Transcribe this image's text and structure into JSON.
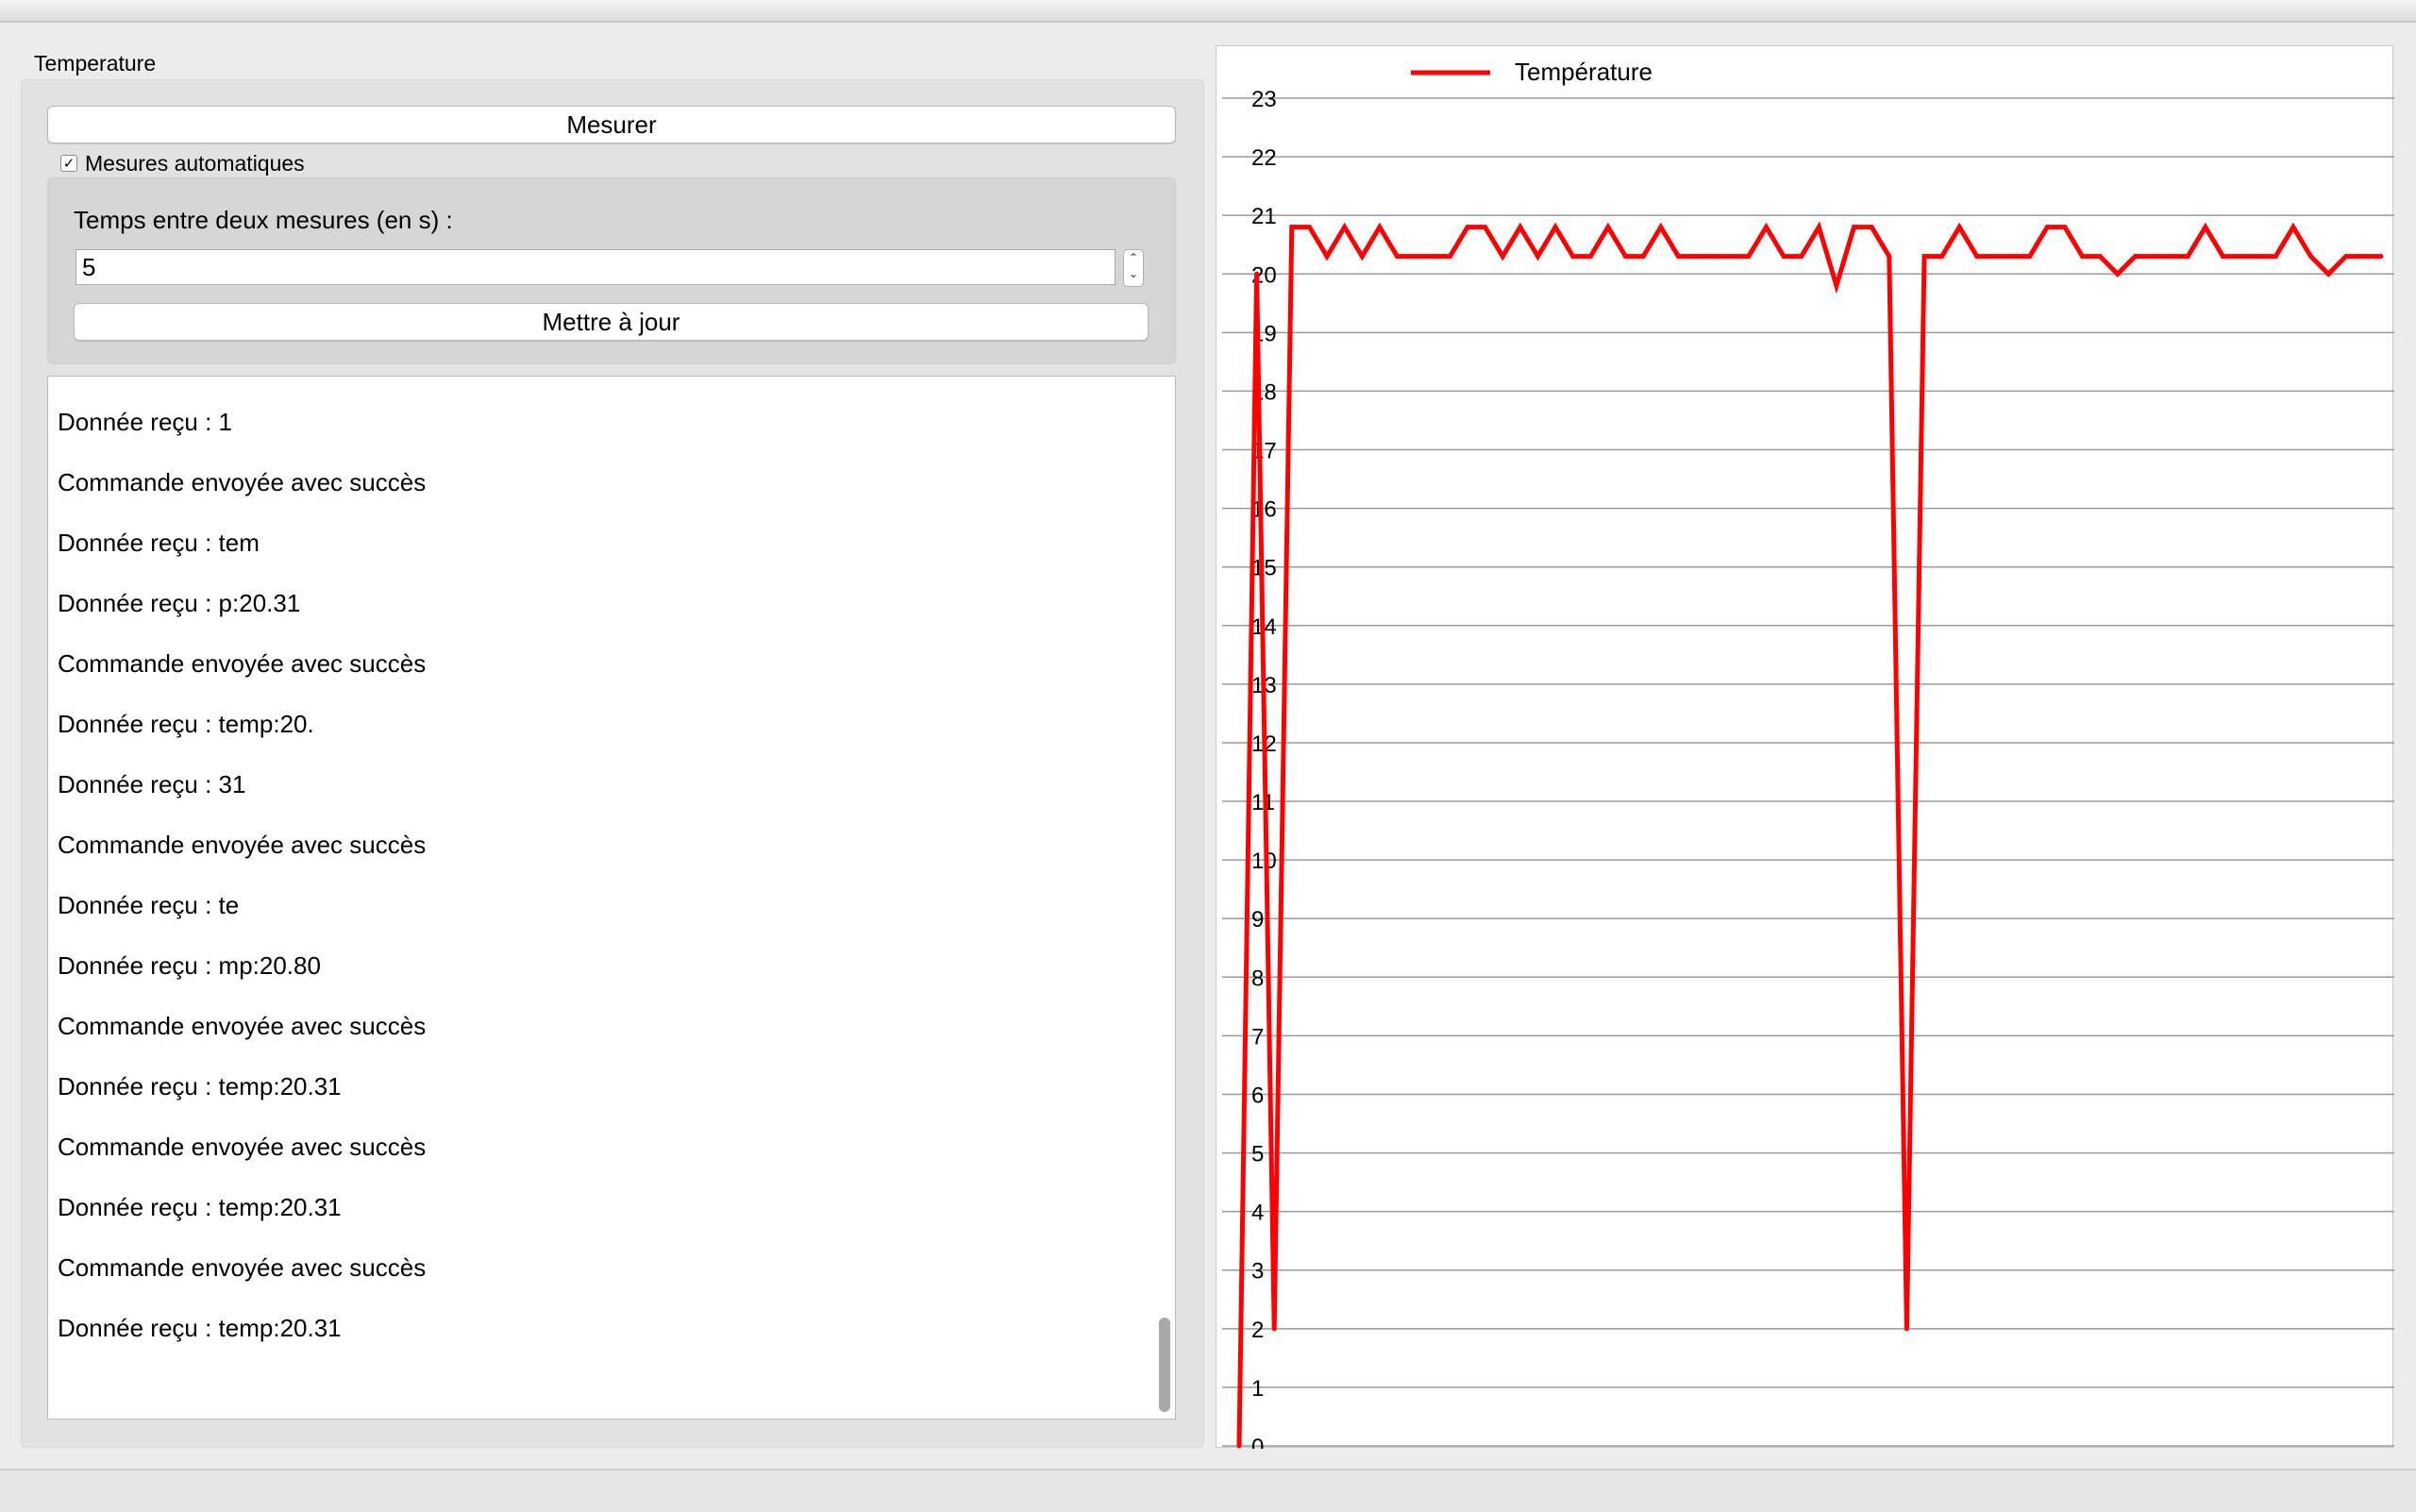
{
  "group": {
    "title": "Temperature"
  },
  "buttons": {
    "measure": "Mesurer",
    "update": "Mettre à jour"
  },
  "auto": {
    "checked": true,
    "check_glyph": "✓",
    "label": "Mesures automatiques"
  },
  "interval": {
    "label": "Temps entre deux mesures (en s) :",
    "value": "5"
  },
  "log": [
    "Donnée reçu : 1",
    "Commande envoyée avec succès",
    "Donnée reçu : tem",
    "Donnée reçu : p:20.31",
    "Commande envoyée avec succès",
    "Donnée reçu : temp:20.",
    "Donnée reçu : 31",
    "Commande envoyée avec succès",
    "Donnée reçu : te",
    "Donnée reçu : mp:20.80",
    "Commande envoyée avec succès",
    "Donnée reçu : temp:20.31",
    "Commande envoyée avec succès",
    "Donnée reçu : temp:20.31",
    "Commande envoyée avec succès",
    "Donnée reçu : temp:20.31"
  ],
  "colors": {
    "series": "#ff0000",
    "grid": "#9a9a9a"
  },
  "chart_data": {
    "type": "line",
    "legend": "top-left",
    "grid": true,
    "ylim": [
      0,
      23
    ],
    "yticks": [
      0,
      1,
      2,
      3,
      4,
      5,
      6,
      7,
      8,
      9,
      10,
      11,
      12,
      13,
      14,
      15,
      16,
      17,
      18,
      19,
      20,
      21,
      22,
      23
    ],
    "series": [
      {
        "name": "Température",
        "values": [
          0,
          20,
          2,
          20.8,
          20.8,
          20.3,
          20.8,
          20.3,
          20.8,
          20.3,
          20.3,
          20.3,
          20.3,
          20.8,
          20.8,
          20.3,
          20.8,
          20.3,
          20.8,
          20.3,
          20.3,
          20.8,
          20.3,
          20.3,
          20.8,
          20.3,
          20.3,
          20.3,
          20.3,
          20.3,
          20.8,
          20.3,
          20.3,
          20.8,
          19.8,
          20.8,
          20.8,
          20.3,
          2,
          20.3,
          20.3,
          20.8,
          20.3,
          20.3,
          20.3,
          20.3,
          20.8,
          20.8,
          20.3,
          20.3,
          20,
          20.3,
          20.3,
          20.3,
          20.3,
          20.8,
          20.3,
          20.3,
          20.3,
          20.3,
          20.8,
          20.3,
          20,
          20.3,
          20.3,
          20.3
        ]
      }
    ]
  }
}
